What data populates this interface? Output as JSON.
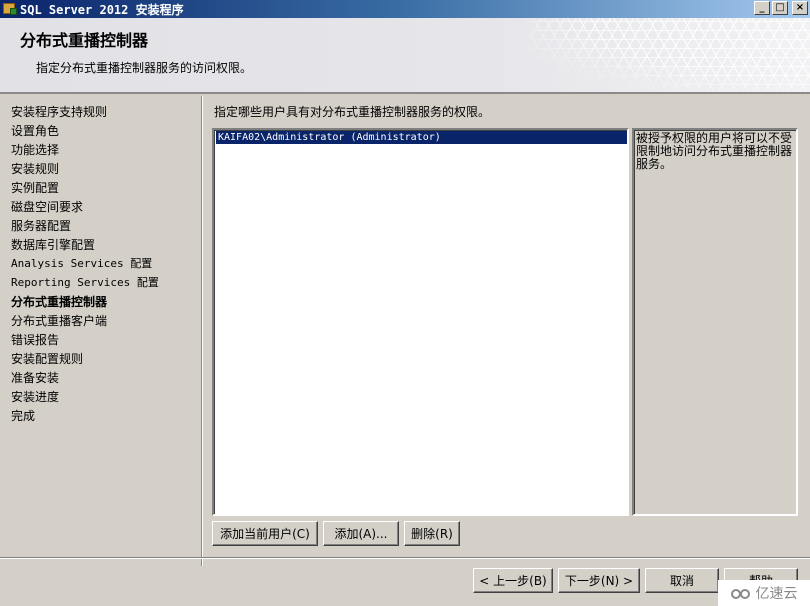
{
  "window": {
    "title": "SQL Server 2012 安装程序",
    "buttons": {
      "minimize": "_",
      "maximize": "□",
      "close": "×"
    }
  },
  "header": {
    "title": "分布式重播控制器",
    "subtitle": "指定分布式重播控制器服务的访问权限。"
  },
  "sidebar": {
    "items": [
      {
        "label": "安装程序支持规则",
        "active": false
      },
      {
        "label": "设置角色",
        "active": false
      },
      {
        "label": "功能选择",
        "active": false
      },
      {
        "label": "安装规则",
        "active": false
      },
      {
        "label": "实例配置",
        "active": false
      },
      {
        "label": "磁盘空间要求",
        "active": false
      },
      {
        "label": "服务器配置",
        "active": false
      },
      {
        "label": "数据库引擎配置",
        "active": false
      },
      {
        "label": "Analysis Services 配置",
        "active": false
      },
      {
        "label": "Reporting Services 配置",
        "active": false
      },
      {
        "label": "分布式重播控制器",
        "active": true
      },
      {
        "label": "分布式重播客户端",
        "active": false
      },
      {
        "label": "错误报告",
        "active": false
      },
      {
        "label": "安装配置规则",
        "active": false
      },
      {
        "label": "准备安装",
        "active": false
      },
      {
        "label": "安装进度",
        "active": false
      },
      {
        "label": "完成",
        "active": false
      }
    ]
  },
  "main": {
    "instruction": "指定哪些用户具有对分布式重播控制器服务的权限。",
    "users": [
      {
        "name": "KAIFA02\\Administrator (Administrator)",
        "selected": true
      }
    ],
    "description": "被授予权限的用户将可以不受限制地访问分布式重播控制器服务。",
    "buttons": {
      "add_current_user": "添加当前用户(C)",
      "add": "添加(A)...",
      "remove": "删除(R)"
    }
  },
  "footer": {
    "back": "< 上一步(B)",
    "next": "下一步(N) >",
    "cancel": "取消",
    "help": "帮助"
  },
  "watermark": {
    "text": "亿速云"
  }
}
